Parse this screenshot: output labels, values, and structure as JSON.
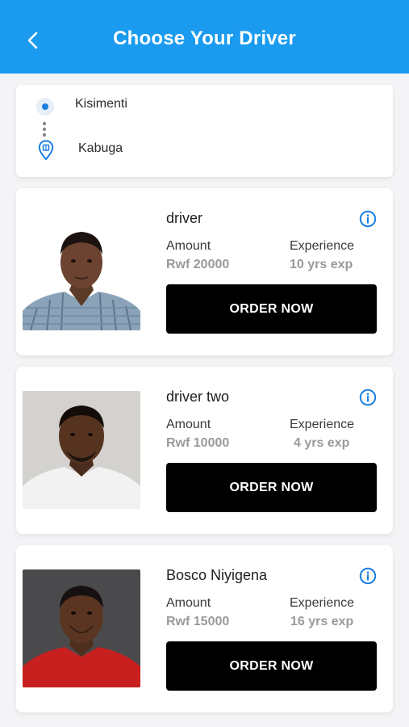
{
  "header": {
    "title": "Choose Your Driver",
    "back_icon": "chevron-left-icon",
    "background": "#1a9bf0"
  },
  "route": {
    "origin": "Kisimenti",
    "destination": "Kabuga",
    "origin_icon": "origin-dot-icon",
    "destination_icon": "destination-pin-icon",
    "accent": "#1a7fe0"
  },
  "labels": {
    "amount": "Amount",
    "experience": "Experience",
    "order": "ORDER NOW"
  },
  "drivers": [
    {
      "name": "driver",
      "amount": "Rwf 20000",
      "experience": "10 yrs exp"
    },
    {
      "name": "driver two",
      "amount": "Rwf 10000",
      "experience": "4 yrs exp"
    },
    {
      "name": "Bosco Niyigena",
      "amount": "Rwf 15000",
      "experience": "16 yrs exp"
    }
  ]
}
